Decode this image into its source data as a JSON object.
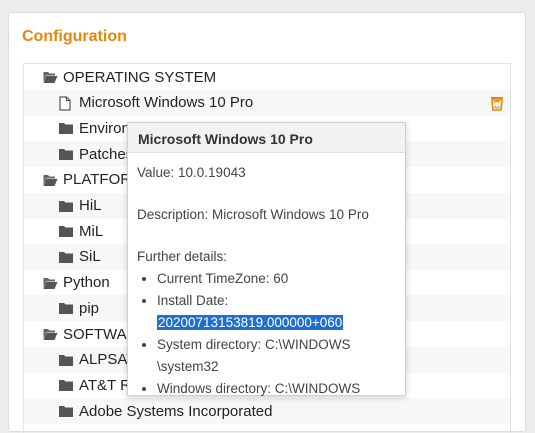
{
  "panel": {
    "title": "Configuration"
  },
  "tree": {
    "rows": [
      {
        "label": "OPERATING SYSTEM",
        "type": "folder-open",
        "level": 0
      },
      {
        "label": "Microsoft Windows 10 Pro",
        "type": "file",
        "level": 1,
        "trash": true
      },
      {
        "label": "Environment",
        "type": "folder",
        "level": 1
      },
      {
        "label": "Patches",
        "type": "folder",
        "level": 1
      },
      {
        "label": "PLATFORMS",
        "type": "folder-open",
        "level": 0
      },
      {
        "label": "HiL",
        "type": "folder",
        "level": 1
      },
      {
        "label": "MiL",
        "type": "folder",
        "level": 1
      },
      {
        "label": "SiL",
        "type": "folder",
        "level": 1
      },
      {
        "label": "Python",
        "type": "folder-open",
        "level": 0
      },
      {
        "label": "pip",
        "type": "folder",
        "level": 1
      },
      {
        "label": "SOFTWARE",
        "type": "folder-open",
        "level": 0
      },
      {
        "label": "ALPSAT",
        "type": "folder",
        "level": 1
      },
      {
        "label": "AT&T Research",
        "type": "folder",
        "level": 1
      },
      {
        "label": "Adobe Systems Incorporated",
        "type": "folder",
        "level": 1
      }
    ]
  },
  "tooltip": {
    "title": "Microsoft Windows 10 Pro",
    "value": "Value: 10.0.19043",
    "description": "Description: Microsoft Windows 10 Pro",
    "further": "Further details:",
    "timezone": "Current TimeZone: 60",
    "install_label": "Install Date:",
    "install_value": "20200713153819.000000+060",
    "sysdir_1": "System directory: C:\\WINDOWS",
    "sysdir_2": "\\system32",
    "windir": "Windows directory: C:\\WINDOWS"
  },
  "colors": {
    "title": "#e8860c",
    "selection": "#1f6fd1",
    "trash": "#e8860c"
  }
}
